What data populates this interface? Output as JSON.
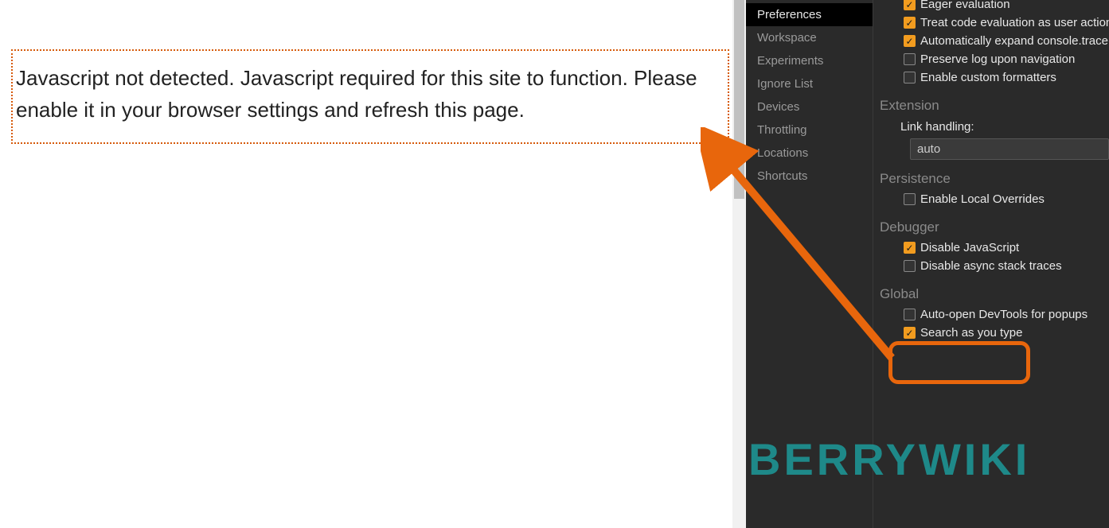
{
  "page": {
    "js_warning": "Javascript not detected. Javascript required for this site to function. Please enable it in your browser settings and refresh this page."
  },
  "sidebar": {
    "items": [
      {
        "label": "Preferences",
        "active": true
      },
      {
        "label": "Workspace",
        "active": false
      },
      {
        "label": "Experiments",
        "active": false
      },
      {
        "label": "Ignore List",
        "active": false
      },
      {
        "label": "Devices",
        "active": false
      },
      {
        "label": "Throttling",
        "active": false
      },
      {
        "label": "Locations",
        "active": false
      },
      {
        "label": "Shortcuts",
        "active": false
      }
    ]
  },
  "settings": {
    "truncated_top": "Eager evaluation",
    "treat_code_eval": "Treat code evaluation as user action",
    "auto_expand_trace": "Automatically expand console.trace()",
    "preserve_log": "Preserve log upon navigation",
    "custom_formatters": "Enable custom formatters",
    "section_extension": "Extension",
    "link_handling_label": "Link handling:",
    "link_handling_value": "auto",
    "section_persistence": "Persistence",
    "local_overrides": "Enable Local Overrides",
    "section_debugger": "Debugger",
    "disable_js": "Disable JavaScript",
    "disable_async": "Disable async stack traces",
    "section_global": "Global",
    "auto_open_devtools": "Auto-open DevTools for popups",
    "search_as_type": "Search as you type"
  },
  "watermark": "BERRYWIKI",
  "checkmark": "✓"
}
